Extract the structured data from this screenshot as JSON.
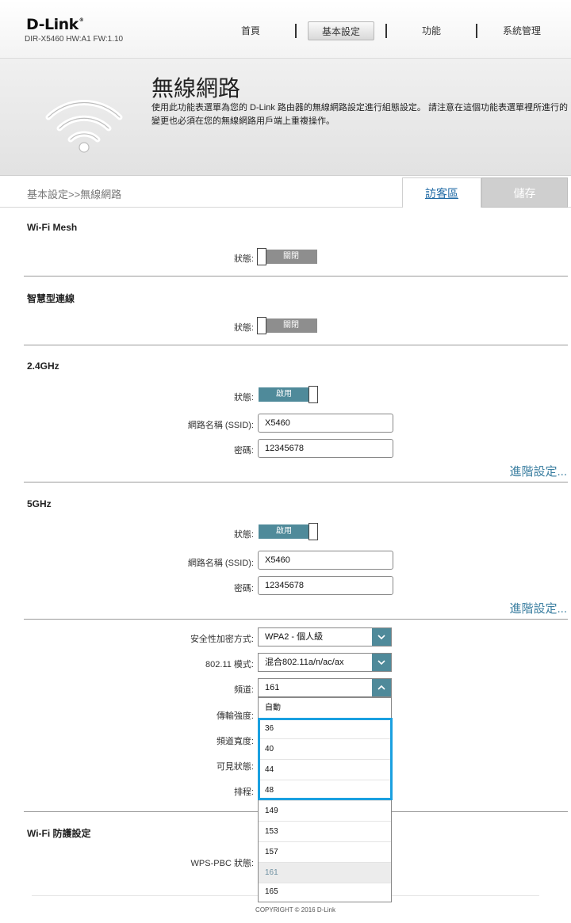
{
  "header": {
    "brand": "D-Link",
    "model": "DIR-X5460 HW:A1 FW:1.10",
    "nav": [
      "首頁",
      "基本設定",
      "功能",
      "系統管理"
    ],
    "active_nav": "基本設定"
  },
  "banner": {
    "title": "無線網路",
    "description": "使用此功能表選單為您的 D-Link 路由器的無線網路設定進行組態設定。 請注意在這個功能表選單裡所進行的變更也必須在您的無線網路用戶端上重複操作。"
  },
  "breadcrumb": "基本設定>>無線網路",
  "buttons": {
    "guest": "訪客區",
    "save": "儲存"
  },
  "mesh": {
    "title": "Wi-Fi Mesh",
    "status_label": "狀態:",
    "status": "關閉"
  },
  "smart": {
    "title": "智慧型連線",
    "status_label": "狀態:",
    "status": "關閉"
  },
  "band24": {
    "title": "2.4GHz",
    "status_label": "狀態:",
    "status": "啟用",
    "ssid_label": "網路名稱 (SSID):",
    "ssid": "X5460",
    "password_label": "密碼:",
    "password": "12345678",
    "advanced": "進階設定..."
  },
  "band5": {
    "title": "5GHz",
    "status_label": "狀態:",
    "status": "啟用",
    "ssid_label": "網路名稱 (SSID):",
    "ssid": "X5460",
    "password_label": "密碼:",
    "password": "12345678",
    "advanced": "進階設定..."
  },
  "settings": {
    "security_label": "安全性加密方式:",
    "security": "WPA2 - 個人級",
    "mode_label": "802.11 模式:",
    "mode": "混合802.11a/n/ac/ax",
    "channel_label": "頻道:",
    "channel": "161",
    "power_label": "傳輸強度:",
    "width_label": "頻道寬度:",
    "visible_label": "可見狀態:",
    "schedule_label": "排程:"
  },
  "channel_options": [
    "自動",
    "36",
    "40",
    "44",
    "48",
    "149",
    "153",
    "157",
    "161",
    "165"
  ],
  "channel_selected": "161",
  "wps": {
    "title": "Wi-Fi 防護設定",
    "status_label": "WPS-PBC 狀態:"
  },
  "footer": {
    "copyright": "COPYRIGHT © 2016 D-Link"
  },
  "colors": {
    "accent": "#4f8a9a",
    "link": "#3a7ea0",
    "highlight": "#1aa0e0"
  }
}
